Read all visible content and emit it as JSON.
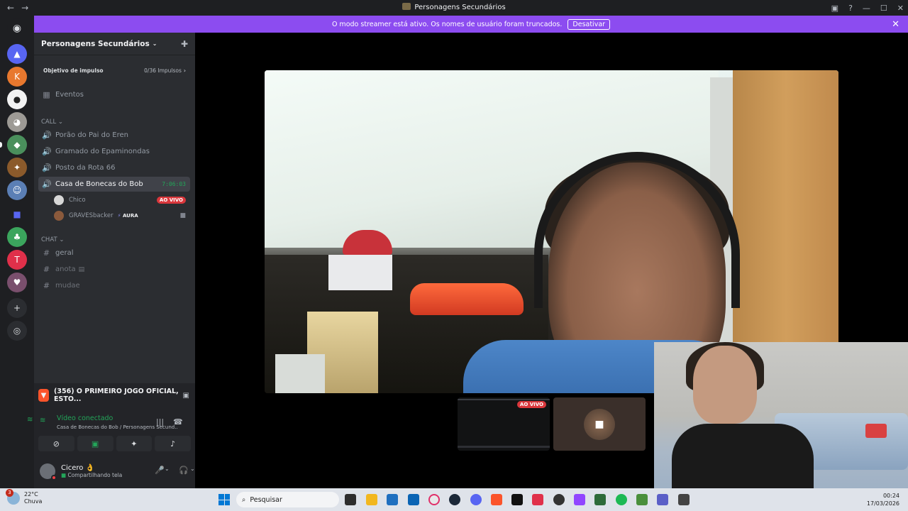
{
  "window": {
    "title": "Personagens Secundários"
  },
  "banner": {
    "text": "O modo streamer está ativo. Os nomes de usuário foram truncados.",
    "button": "Desativar"
  },
  "guild": {
    "name": "Personagens Secundários",
    "boost_label": "Objetivo de impulso",
    "boost_count": "0/36 Impulsos"
  },
  "events_label": "Eventos",
  "call": {
    "category": "CALL",
    "channels": [
      "Porão do Pai do Eren",
      "Gramado do Epaminondas",
      "Posto da Rota 66"
    ],
    "active_channel": "Casa de Bonecas do Bob",
    "active_time": "7:06:03",
    "members": [
      {
        "name": "Chico",
        "badge": "AO VIVO"
      },
      {
        "name": "GRAVESbacker",
        "tag": "AURA"
      }
    ]
  },
  "chat": {
    "category": "CHAT",
    "channels": [
      "geral",
      "anota",
      "mudae"
    ]
  },
  "activity": {
    "text": "(356) O PRIMEIRO JOGO OFICIAL, ESTO..."
  },
  "voice": {
    "status": "Vídeo conectado",
    "location": "Casa de Bonecas do Bob / Personagens Secund..."
  },
  "user": {
    "name": "Cicero",
    "emoji": "👌",
    "status": "Compartilhando tela"
  },
  "stage": {
    "thumb_badge": "AO VIVO"
  },
  "taskbar": {
    "temp": "22°C",
    "weather": "Chuva",
    "weather_badge": "3",
    "search": "Pesquisar",
    "time": "00:24",
    "date": "17/03/2026"
  },
  "colors": {
    "accent": "#8c4cf0",
    "online": "#23a559",
    "live": "#da373c"
  }
}
